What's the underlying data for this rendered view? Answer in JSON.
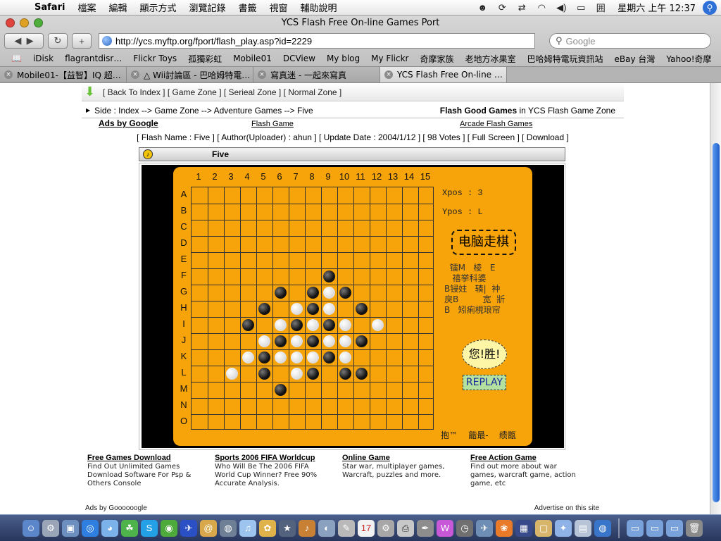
{
  "menubar": {
    "app_name": "Safari",
    "items": [
      "檔案",
      "編輯",
      "顯示方式",
      "瀏覽記錄",
      "書籤",
      "視窗",
      "輔助說明"
    ],
    "clock": "星期六 上午 12:37"
  },
  "window": {
    "title": "YCS Flash Free On-line Games Port"
  },
  "toolbar": {
    "url": "http://ycs.myftp.org/fport/flash_play.asp?id=2229",
    "search_placeholder": "Google"
  },
  "bookmarks": [
    "iDisk",
    "flagrantdisr…",
    "Flickr Toys",
    "孤獨彩虹",
    "Mobile01",
    "DCView",
    "My blog",
    "My Flickr",
    "奇摩家族",
    "老地方冰果室",
    "巴哈姆特電玩資訊站",
    "eBay 台灣",
    "Yahoo!奇摩"
  ],
  "tabs": [
    {
      "label": "Mobile01-【益智】IQ 超…",
      "active": false
    },
    {
      "label": "△ Wii討論區 - 巴哈姆特電…",
      "active": false
    },
    {
      "label": "寫真迷 - 一起來寫真",
      "active": false
    },
    {
      "label": "YCS Flash Free On-line …",
      "active": true
    }
  ],
  "page": {
    "zone_links": "[ Back To Index ]  [ Game Zone ]  [ Serieal Zone ]  [ Normal Zone ]",
    "breadcrumb": "Side : Index --> Game Zone --> Adventure Games --> Five",
    "crumb_right_bold": "Flash Good Games",
    "crumb_right_rest": " in YCS Flash Game Zone",
    "ads_by_google": "Ads by Google",
    "flash_game_link": "Flash Game",
    "arcade_link": "Arcade Flash Games",
    "meta": "[ Flash Name : Five ] [ Author(Uploader) : ahun ] [ Update Date : 2004/1/12 ] [ 98 Votes ] [ Full Screen ] [ Download ]",
    "game_title": "Five"
  },
  "game": {
    "columns": [
      "1",
      "2",
      "3",
      "4",
      "5",
      "6",
      "7",
      "8",
      "9",
      "10",
      "11",
      "12",
      "13",
      "14",
      "15"
    ],
    "rows": [
      "A",
      "B",
      "C",
      "D",
      "E",
      "F",
      "G",
      "H",
      "I",
      "J",
      "K",
      "L",
      "M",
      "N",
      "O"
    ],
    "xpos_label": "Xpos : 3",
    "ypos_label": "Ypos : L",
    "ai_button": "电脑走棋",
    "garbled_text": "  镭M   棱   E\n   禧挙科婆\nB锓妵   辏|  衶\n戾B         宽  斨\nB   矧痢梘琅帘",
    "win_text": "您!胜!",
    "replay_label": "REPLAY",
    "footer_text": "抱™    龤最-    缋甑",
    "stones": [
      {
        "row": "F",
        "col": 9,
        "color": "black"
      },
      {
        "row": "G",
        "col": 6,
        "color": "black"
      },
      {
        "row": "G",
        "col": 8,
        "color": "black"
      },
      {
        "row": "G",
        "col": 9,
        "color": "white"
      },
      {
        "row": "G",
        "col": 10,
        "color": "black"
      },
      {
        "row": "H",
        "col": 5,
        "color": "black"
      },
      {
        "row": "H",
        "col": 7,
        "color": "white"
      },
      {
        "row": "H",
        "col": 8,
        "color": "black"
      },
      {
        "row": "H",
        "col": 9,
        "color": "white"
      },
      {
        "row": "H",
        "col": 11,
        "color": "black"
      },
      {
        "row": "I",
        "col": 4,
        "color": "black"
      },
      {
        "row": "I",
        "col": 6,
        "color": "white"
      },
      {
        "row": "I",
        "col": 7,
        "color": "black"
      },
      {
        "row": "I",
        "col": 8,
        "color": "white"
      },
      {
        "row": "I",
        "col": 9,
        "color": "black"
      },
      {
        "row": "I",
        "col": 10,
        "color": "white"
      },
      {
        "row": "I",
        "col": 12,
        "color": "white"
      },
      {
        "row": "J",
        "col": 5,
        "color": "white"
      },
      {
        "row": "J",
        "col": 6,
        "color": "black"
      },
      {
        "row": "J",
        "col": 7,
        "color": "white"
      },
      {
        "row": "J",
        "col": 8,
        "color": "black"
      },
      {
        "row": "J",
        "col": 9,
        "color": "white"
      },
      {
        "row": "J",
        "col": 10,
        "color": "white"
      },
      {
        "row": "J",
        "col": 11,
        "color": "black"
      },
      {
        "row": "K",
        "col": 4,
        "color": "white"
      },
      {
        "row": "K",
        "col": 5,
        "color": "black"
      },
      {
        "row": "K",
        "col": 6,
        "color": "white"
      },
      {
        "row": "K",
        "col": 7,
        "color": "white"
      },
      {
        "row": "K",
        "col": 8,
        "color": "white"
      },
      {
        "row": "K",
        "col": 9,
        "color": "black"
      },
      {
        "row": "K",
        "col": 10,
        "color": "white"
      },
      {
        "row": "L",
        "col": 3,
        "color": "white"
      },
      {
        "row": "L",
        "col": 5,
        "color": "black"
      },
      {
        "row": "L",
        "col": 7,
        "color": "white"
      },
      {
        "row": "L",
        "col": 8,
        "color": "black"
      },
      {
        "row": "L",
        "col": 10,
        "color": "black"
      },
      {
        "row": "L",
        "col": 11,
        "color": "black"
      },
      {
        "row": "M",
        "col": 6,
        "color": "black"
      }
    ]
  },
  "ads": [
    {
      "title": "Free Games Download",
      "body": "Find Out Unlimited Games Download Software For Psp & Others Console"
    },
    {
      "title": "Sports 2006 FIFA Worldcup",
      "body": "Who Will Be The 2006 FIFA World Cup Winner? Free 90% Accurate Analysis."
    },
    {
      "title": "Online Game",
      "body": "Star war, multiplayer games, Warcraft, puzzles and more."
    },
    {
      "title": "Free Action Game",
      "body": "Find out more about war games, warcraft game, action game, etc"
    }
  ],
  "ads_footer_left": "Ads by Goooooogle",
  "ads_footer_right": "Advertise on this site",
  "colors": {
    "board_orange": "#f7a30a",
    "flash_bg": "#000000",
    "accent_blue": "#2e6fd8"
  }
}
